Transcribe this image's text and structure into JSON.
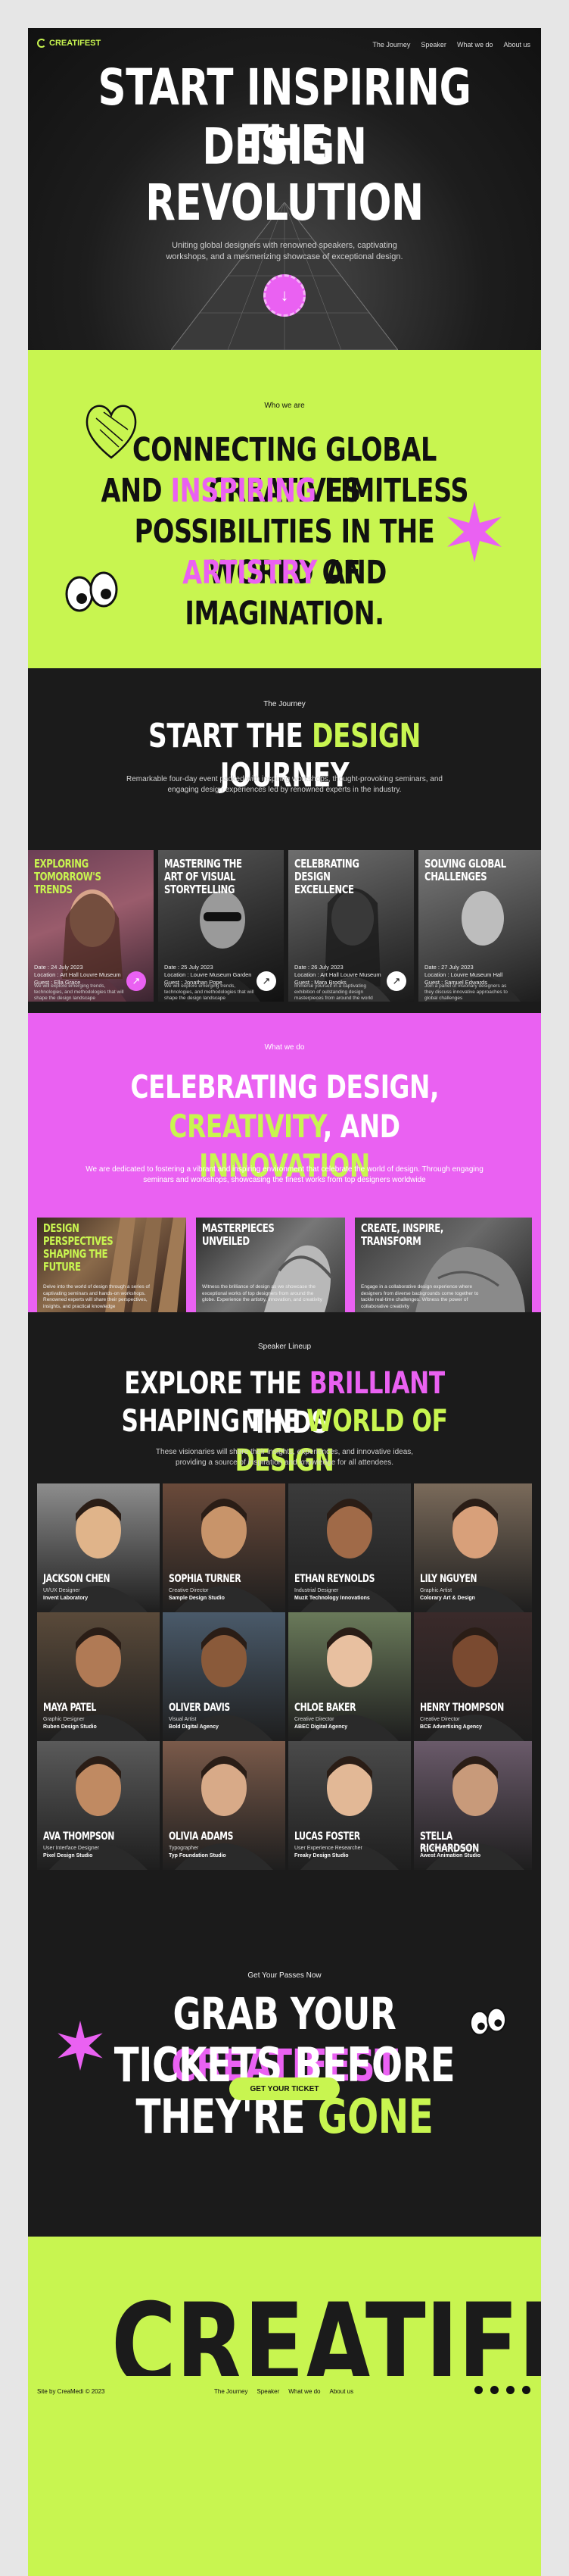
{
  "nav": {
    "logo": "CREATIFEST",
    "links": [
      "The Journey",
      "Speaker",
      "What we do",
      "About us"
    ]
  },
  "hero": {
    "title_line1": "START INSPIRING THE",
    "title_line2": "DESIGN REVOLUTION",
    "subtitle": "Uniting global designers with renowned speakers, captivating workshops, and a mesmerizing showcase of exceptional design."
  },
  "who": {
    "eyebrow": "Who we are",
    "line1": "CONNECTING GLOBAL CREATIVES",
    "line2_a": "AND ",
    "line2_b": "INSPIRING",
    "line2_c": " LIMITLESS",
    "line3": "POSSIBILITIES IN THE WORLD OF",
    "line4_a": "ARTISTRY",
    "line4_b": " AND IMAGINATION."
  },
  "journey": {
    "eyebrow": "The Journey",
    "title_a": "START THE ",
    "title_b": "DESIGN",
    "title_c": " JOURNEY",
    "subtitle": "Remarkable four-day event packed with inspiring workshops, thought-provoking seminars, and engaging design experiences led by renowned experts in the industry.",
    "cards": [
      {
        "title": "EXPLORING TOMORROW'S TRENDS",
        "date": "Date : 24 July 2023",
        "location": "Location : Art Hall Louvre Museum",
        "guest": "Guest : Ella Grace",
        "desc": "We will explore emerging trends, technologies, and methodologies that will shape the design landscape"
      },
      {
        "title": "MASTERING THE ART OF VISUAL STORYTELLING",
        "date": "Date : 25 July 2023",
        "location": "Location : Louvre Museum Garden",
        "guest": "Guest : Jonathan Pope",
        "desc": "We will explore emerging trends, technologies, and methodologies that will shape the design landscape"
      },
      {
        "title": "CELEBRATING DESIGN EXCELLENCE",
        "date": "Date : 26 July 2023",
        "location": "Location : Art Hall Louvre Museum",
        "guest": "Guest : Mara Brooks",
        "desc": "Immerse yourself in a captivating exhibition of outstanding design masterpieces from around the world"
      },
      {
        "title": "SOLVING GLOBAL CHALLENGES",
        "date": "Date : 27 July 2023",
        "location": "Location : Louvre Museum Hall",
        "guest": "Guest : Samuel Edwards",
        "desc": "Join a panel of visionary designers as they discuss innovative approaches to global challenges"
      }
    ]
  },
  "what": {
    "eyebrow": "What we do",
    "line1": "CELEBRATING DESIGN,",
    "line2_a": "CREATIVITY",
    "line2_b": ", AND ",
    "line2_c": "INNOVATION",
    "subtitle": "We are dedicated to fostering a vibrant and inspiring environment that celebrate the world of design. Through engaging seminars and workshops, showcasing the finest works from top designers worldwide",
    "cards": [
      {
        "title": "DESIGN PERSPECTIVES SHAPING THE FUTURE",
        "desc": "Delve into the world of design through a series of captivating seminars and hands-on workshops. Renowned experts will share their perspectives, insights, and practical knowledge"
      },
      {
        "title": "MASTERPIECES UNVEILED",
        "desc": "Witness the brilliance of design as we showcase the exceptional works of top designers from around the globe. Experience the artistry, innovation, and creativity"
      },
      {
        "title": "CREATE, INSPIRE, TRANSFORM",
        "desc": "Engage in a collaborative design experience where designers from diverse backgrounds come together to tackle real-time challenges. Witness the power of collaborative creativity"
      }
    ]
  },
  "speakers": {
    "eyebrow": "Speaker Lineup",
    "line1_a": "EXPLORE THE ",
    "line1_b": "BRILLIANT",
    "line1_c": " MINDS",
    "line2_a": "SHAPING THE ",
    "line2_b": "WORLD OF DESIGN",
    "subtitle": "These visionaries will share their insights, experiences, and innovative ideas, providing a source of inspiration and knowledge for all attendees.",
    "people": [
      {
        "name": "JACKSON CHEN",
        "role": "UI/UX Designer",
        "company": "Invent Laboratory"
      },
      {
        "name": "SOPHIA TURNER",
        "role": "Creative Director",
        "company": "Sample Design Studio"
      },
      {
        "name": "ETHAN REYNOLDS",
        "role": "Industrial Designer",
        "company": "Muzit Technology Innovations"
      },
      {
        "name": "LILY NGUYEN",
        "role": "Graphic Artist",
        "company": "Colorary Art & Design"
      },
      {
        "name": "MAYA PATEL",
        "role": "Graphic Designer",
        "company": "Ruben Design Studio"
      },
      {
        "name": "OLIVER DAVIS",
        "role": "Visual Artist",
        "company": "Bold Digital Agency"
      },
      {
        "name": "CHLOE BAKER",
        "role": "Creative Director",
        "company": "ABEC Digital Agency"
      },
      {
        "name": "HENRY THOMPSON",
        "role": "Creative Director",
        "company": "BCE Advertising Agency"
      },
      {
        "name": "AVA THOMPSON",
        "role": "User Interface Designer",
        "company": "Pixel Design Studio"
      },
      {
        "name": "OLIVIA ADAMS",
        "role": "Typographer",
        "company": "Typ Foundation Studio"
      },
      {
        "name": "LUCAS FOSTER",
        "role": "User Experience Researcher",
        "company": "Freaky Design Studio"
      },
      {
        "name": "STELLA RICHARDSON",
        "role": "Motion Graphic Designer",
        "company": "Awest Animation Studio"
      }
    ]
  },
  "tickets": {
    "eyebrow": "Get Your Passes Now",
    "line1_a": "GRAB YOUR ",
    "line1_b": "CREATIFEST",
    "line2_a": "TICKETS BEFORE THEY'RE ",
    "line2_b": "GONE",
    "button": "GET YOUR TICKET"
  },
  "footer": {
    "big_word": "CREATIFEST",
    "credit": "Site by CreaMedi © 2023",
    "links": [
      "The Journey",
      "Speaker",
      "What we do",
      "About us"
    ],
    "social_icons": [
      "discord-icon",
      "facebook-icon",
      "instagram-icon",
      "twitter-icon"
    ]
  },
  "colors": {
    "lime": "#c8f550",
    "pink": "#ea61f2",
    "dark": "#1b1b1b"
  }
}
